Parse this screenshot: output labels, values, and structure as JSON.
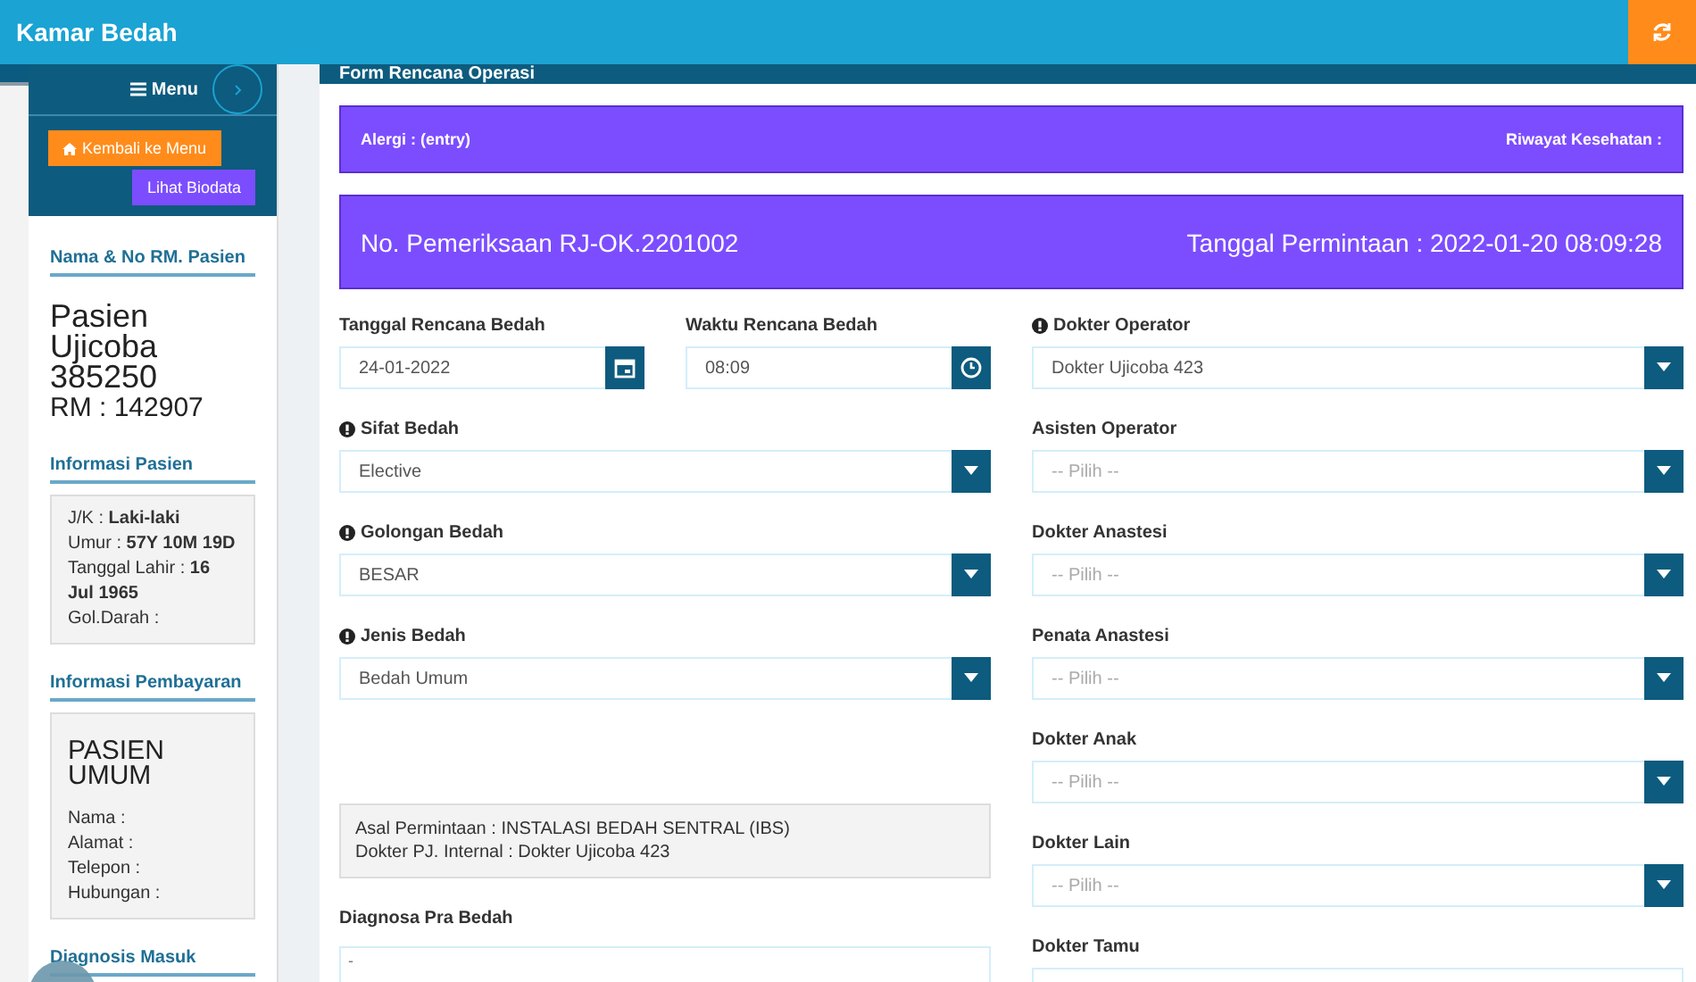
{
  "app_bar": {
    "title": "Kamar Bedah"
  },
  "sidebar": {
    "menu_label": "Menu",
    "buttons": [
      {
        "label": "Kembali ke Menu",
        "kind": "back"
      },
      {
        "label": "Lihat Biodata",
        "kind": "biodata"
      }
    ],
    "patient": {
      "heading": "Nama & No RM. Pasien",
      "name": "Pasien Ujicoba 385250",
      "rm": "RM : 142907"
    },
    "info": {
      "heading": "Informasi Pasien",
      "lines": [
        "J/K : **Laki-laki**",
        "Umur : **57Y 10M 19D**",
        "Tanggal Lahir : **16 Jul 1965**",
        "Gol.Darah :"
      ]
    },
    "payment": {
      "heading": "Informasi Pembayaran",
      "type": "PASIEN UMUM",
      "lines": [
        "Nama :",
        "Alamat :",
        "Telepon :",
        "Hubungan :"
      ]
    },
    "next_heading": "Diagnosis Masuk"
  },
  "form": {
    "title": "Form Rencana Operasi",
    "allergy_bar": {
      "left": "Alergi : (entry)",
      "right": "Riwayat Kesehatan :"
    },
    "exam_bar": {
      "left": "No. Pemeriksaan RJ-OK.2201002",
      "right": "Tanggal Permintaan : 2022-01-20 08:09:28"
    },
    "schedule": [
      {
        "label": "Tanggal Rencana Bedah",
        "value": "24-01-2022",
        "kind": "date"
      },
      {
        "label": "Waktu Rencana Bedah",
        "value": "08:09",
        "kind": "time"
      }
    ],
    "left_fields": [
      {
        "label": "Sifat Bedah",
        "required": true,
        "kind": "select",
        "value": "Elective"
      },
      {
        "label": "Golongan Bedah",
        "required": true,
        "kind": "select",
        "value": "BESAR"
      },
      {
        "label": "Jenis Bedah",
        "required": true,
        "kind": "select",
        "value": "Bedah Umum"
      }
    ],
    "request_info": [
      "Asal Permintaan : INSTALASI BEDAH SENTRAL (IBS)",
      "Dokter PJ. Internal : Dokter Ujicoba 423"
    ],
    "diagnosis": {
      "label": "Diagnosa Pra Bedah",
      "value": "-"
    },
    "right_fields": [
      {
        "label": "Dokter Operator",
        "required": true,
        "kind": "select",
        "value": "Dokter Ujicoba 423"
      },
      {
        "label": "Asisten Operator",
        "required": false,
        "kind": "select",
        "placeholder": "-- Pilih --"
      },
      {
        "label": "Dokter Anastesi",
        "required": false,
        "kind": "select",
        "placeholder": "-- Pilih --"
      },
      {
        "label": "Penata Anastesi",
        "required": false,
        "kind": "select",
        "placeholder": "-- Pilih --"
      },
      {
        "label": "Dokter Anak",
        "required": false,
        "kind": "select",
        "placeholder": "-- Pilih --"
      },
      {
        "label": "Dokter Lain",
        "required": false,
        "kind": "select",
        "placeholder": "-- Pilih --"
      },
      {
        "label": "Dokter Tamu",
        "required": false,
        "kind": "text"
      }
    ]
  }
}
